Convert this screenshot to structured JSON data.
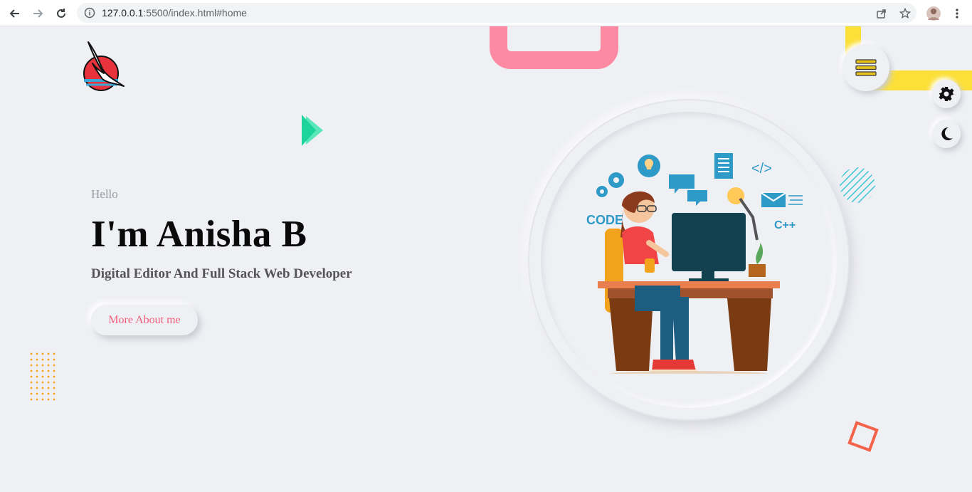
{
  "browser": {
    "url_host": "127.0.0.1",
    "url_rest": ":5500/index.html#home"
  },
  "hero": {
    "greeting": "Hello",
    "name": "I'm Anisha B",
    "role": "Digital Editor And Full Stack Web Developer",
    "cta_label": "More About me"
  },
  "illustration": {
    "code_label": "CODE",
    "cpp_label": "C++",
    "tag_label": "</>"
  },
  "colors": {
    "accent_pink": "#f0607e",
    "accent_yellow": "#fce038",
    "accent_green": "#1dd39d",
    "accent_orange": "#f4a31a",
    "accent_red": "#f2634a",
    "page_bg": "#eff0f4"
  },
  "icons": [
    "back-icon",
    "forward-icon",
    "reload-icon",
    "info-icon",
    "share-icon",
    "star-icon",
    "profile-avatar",
    "kebab-menu-icon",
    "hamburger-menu-icon",
    "gear-icon",
    "moon-icon",
    "logo"
  ]
}
